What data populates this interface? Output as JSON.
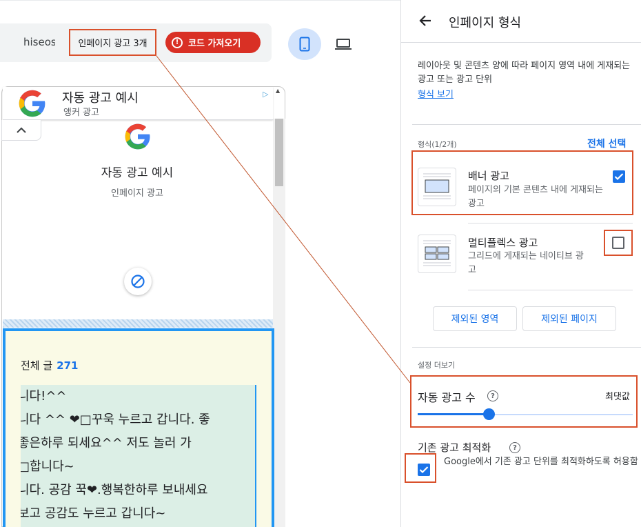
{
  "toolbar": {
    "site": "hiseos",
    "ad_count": "인페이지 광고 3개",
    "get_code": "코드 가져오기"
  },
  "preview": {
    "anchor_title": "자동 광고 예시",
    "anchor_sub": "앵커 광고",
    "inpage_title": "자동 광고 예시",
    "inpage_sub": "인페이지 광고",
    "posts_label": "전체 글",
    "posts_count": "271",
    "comments": [
      "니다!^^",
      "니다 ^^ ❤□꾸욱 누르고 갑니다. 좋",
      " 좋은하루 되세요^^ 저도 놀러 가",
      "□합니다~",
      "니다. 공감 꾹❤.행복한하루 보내세요",
      "보고 공감도 누르고 갑니다~"
    ]
  },
  "panel": {
    "title": "인페이지 형식",
    "description": "레이아웃 및 콘텐츠 양에 따라 페이지 영역 내에 게재되는 광고 또는 광고 단위",
    "view_format": "형식 보기",
    "formats_label": "형식(1/2개)",
    "select_all": "전체 선택",
    "banner": {
      "title": "배너 광고",
      "desc": "페이지의 기본 콘텐츠 내에 게재되는 광고",
      "checked": true
    },
    "multiplex": {
      "title": "멀티플렉스 광고",
      "desc": "그리드에 게재되는 네이티브 광고",
      "checked": false
    },
    "excluded_areas": "제외된 영역",
    "excluded_pages": "제외된 페이지",
    "more_settings": "설정 더보기",
    "ad_load": "자동 광고 수",
    "max": "최댓값",
    "ad_load_level": 0.33,
    "optimize_title": "기존 광고 최적화",
    "optimize_desc": "Google에서 기존 광고 단위를 최적화하도록 허용함",
    "optimize_checked": true
  },
  "colors": {
    "accent": "#1a73e8",
    "danger": "#d93025",
    "highlight": "#d9502b"
  }
}
